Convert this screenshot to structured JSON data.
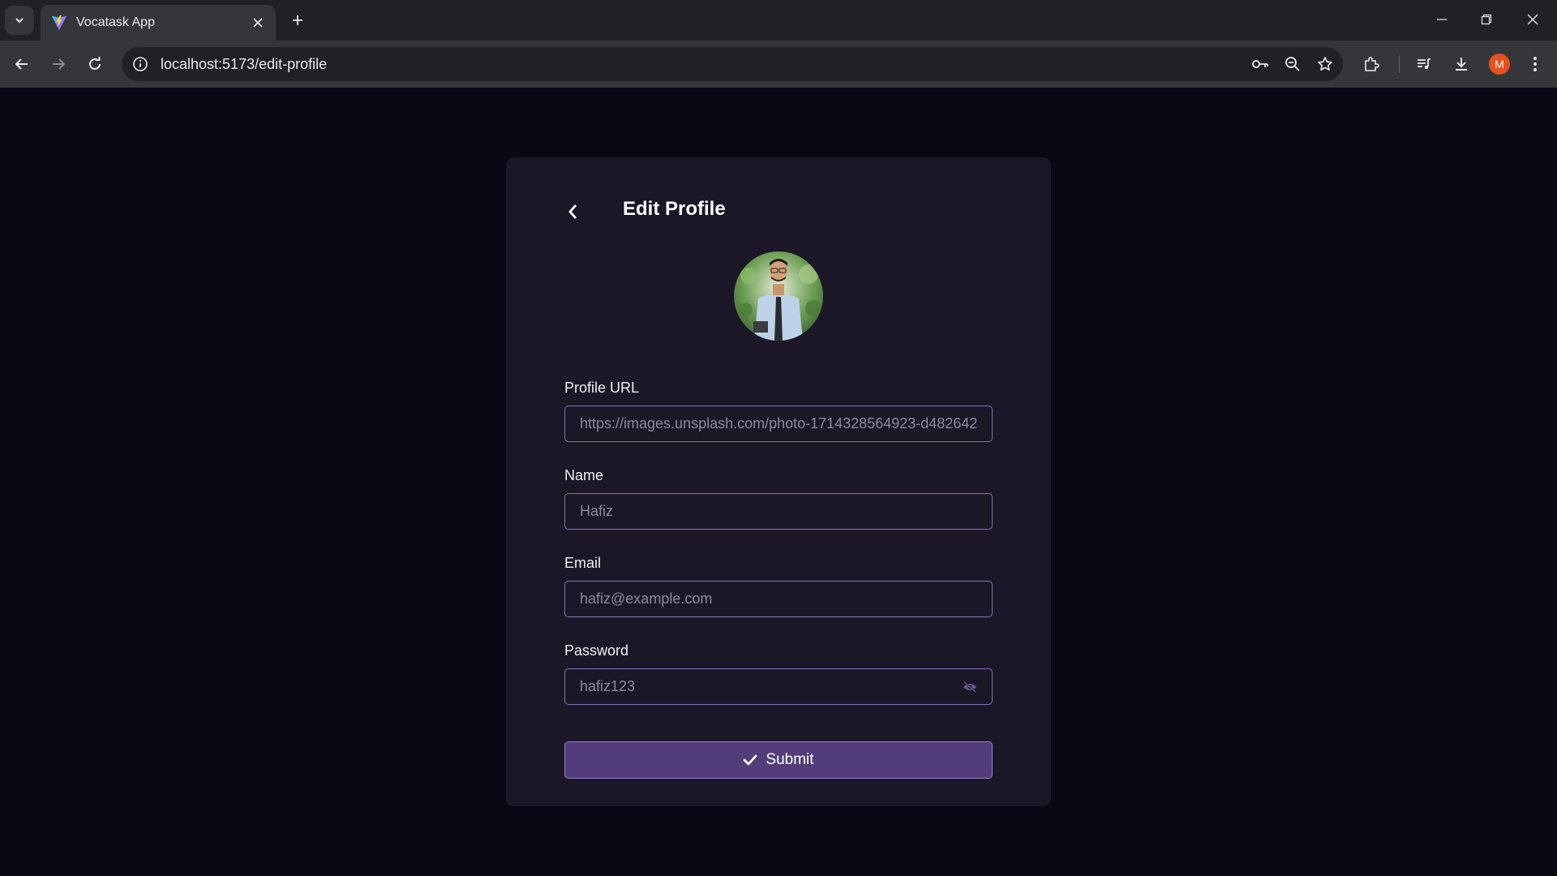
{
  "browser": {
    "tab_title": "Vocatask App",
    "url": "localhost:5173/edit-profile",
    "profile_initial": "M"
  },
  "page": {
    "title": "Edit Profile"
  },
  "form": {
    "profile_url": {
      "label": "Profile URL",
      "value": "https://images.unsplash.com/photo-1714328564923-d482642"
    },
    "name": {
      "label": "Name",
      "value": "Hafiz"
    },
    "email": {
      "label": "Email",
      "value": "hafiz@example.com"
    },
    "password": {
      "label": "Password",
      "value": "hafiz123"
    },
    "submit_label": "Submit"
  },
  "colors": {
    "background": "#0c0714",
    "card": "#1b1726",
    "accent": "#523c79",
    "field_border": "#8a6fc2"
  }
}
